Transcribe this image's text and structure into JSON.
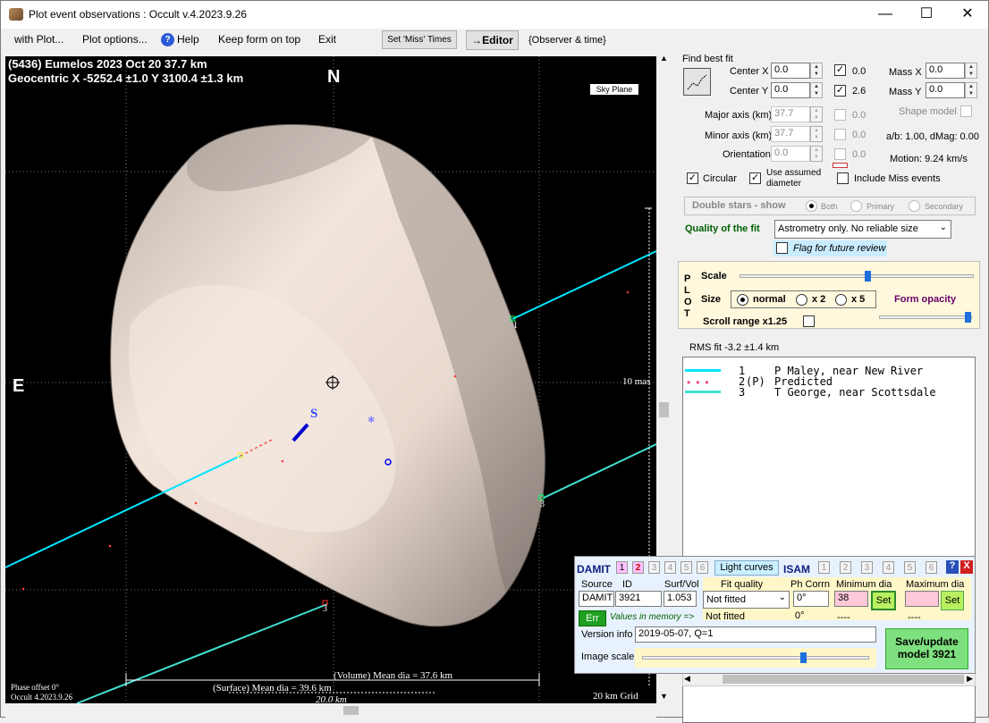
{
  "window": {
    "title": "Plot event observations : Occult v.4.2023.9.26",
    "minimize": "—",
    "maximize": "☐",
    "close": "✕"
  },
  "menu": {
    "with_plot": "with Plot...",
    "plot_options": "Plot options...",
    "help": "Help",
    "keep_on_top": "Keep form on top",
    "exit": "Exit",
    "set_miss_times": "Set 'Miss' Times",
    "editor": "→Editor",
    "observer_time": "{Observer & time}"
  },
  "plot": {
    "header_line1": "(5436) Eumelos  2023 Oct 20  37.7 km",
    "header_line2": "Geocentric  X  -5252.4 ±1.0  Y 3100.4 ±1.3 km",
    "north": "N",
    "east": "E",
    "sky_plane": "Sky Plane",
    "scale_mas": "10 mas",
    "center_label": "S",
    "chord1_label": "1",
    "chord3_label": "3",
    "phase_offset": "Phase offset 0°",
    "version": "Occult 4.2023.9.26",
    "volume_dia": "(Volume) Mean dia = 37.6 km",
    "surface_dia": "(Surface) Mean dia = 39.6 km",
    "scale_bar": "20.0 km",
    "grid": "20 km Grid"
  },
  "fit": {
    "find_best_fit": "Find best fit",
    "center_x_label": "Center X",
    "center_x": "0.0",
    "center_y_label": "Center Y",
    "center_y": "0.0",
    "cx_check": "0.0",
    "cy_check": "2.6",
    "mass_x_label": "Mass X",
    "mass_x": "0.0",
    "mass_y_label": "Mass Y",
    "mass_y": "0.0",
    "major_label": "Major axis (km)",
    "major": "37.7",
    "major_chk": "0.0",
    "minor_label": "Minor axis (km)",
    "minor": "37.7",
    "minor_chk": "0.0",
    "orient_label": "Orientation",
    "orient": "0.0",
    "orient_chk": "0.0",
    "shape_model": "Shape model",
    "ab_dmag": "a/b: 1.00, dMag: 0.00",
    "motion": "Motion: 9.24 km/s",
    "circular": "Circular",
    "use_assumed": "Use assumed",
    "diameter": "diameter",
    "include_miss": "Include Miss events",
    "double_stars": "Double stars - show",
    "both": "Both",
    "primary": "Primary",
    "secondary": "Secondary",
    "quality_label": "Quality of the fit",
    "quality_value": "Astrometry only. No reliable size",
    "flag_review": "Flag for future review"
  },
  "plotpanel": {
    "p": "P",
    "l": "L",
    "o": "O",
    "t": "T",
    "scale": "Scale",
    "size": "Size",
    "normal": "normal",
    "x2": "x 2",
    "x5": "x 5",
    "form_opacity": "Form opacity",
    "scroll_range": "Scroll range x1.25",
    "scale_level": 0.55,
    "opacity_level": 1.0
  },
  "rms": "RMS fit -3.2 ±1.4 km",
  "observers": [
    {
      "num": "1",
      "tag": "   ",
      "name": "P Maley, near New River",
      "color": "#00e5ff",
      "style": "solid"
    },
    {
      "num": "2",
      "tag": "(P)",
      "name": "Predicted",
      "color": "#ff3b7a",
      "style": "dots"
    },
    {
      "num": "3",
      "tag": "   ",
      "name": "T George, near Scottsdale",
      "color": "#40e0d0",
      "style": "solid"
    }
  ],
  "damit": {
    "damit": "DAMIT",
    "isam": "ISAM",
    "light_curves": "Light curves",
    "nums": [
      "1",
      "2",
      "3",
      "4",
      "5",
      "6"
    ],
    "help": "?",
    "close": "X",
    "source_label": "Source",
    "id_label": "ID",
    "surfvol_label": "Surf/Vol",
    "source": "DAMIT",
    "id": "3921",
    "surfvol": "1.053",
    "fit_quality_label": "Fit quality",
    "fit_quality": "Not fitted",
    "fit_quality_mem": "Not fitted",
    "ph_corrn_label": "Ph Corrn",
    "ph_corrn": "0°",
    "ph_corrn_mem": "0°",
    "min_dia_label": "Minimum dia",
    "min_dia": "38",
    "min_dia_mem": "----",
    "max_dia_label": "Maximum dia",
    "max_dia": "",
    "max_dia_mem": "----",
    "set": "Set",
    "err": "Err",
    "values_in_memory": "Values in memory =>",
    "version_label": "Version info",
    "version": "2019-05-07, Q=1",
    "image_scale_label": "Image scale",
    "save_update": "Save/update",
    "model": "model 3921",
    "image_scale_level": 0.72
  }
}
